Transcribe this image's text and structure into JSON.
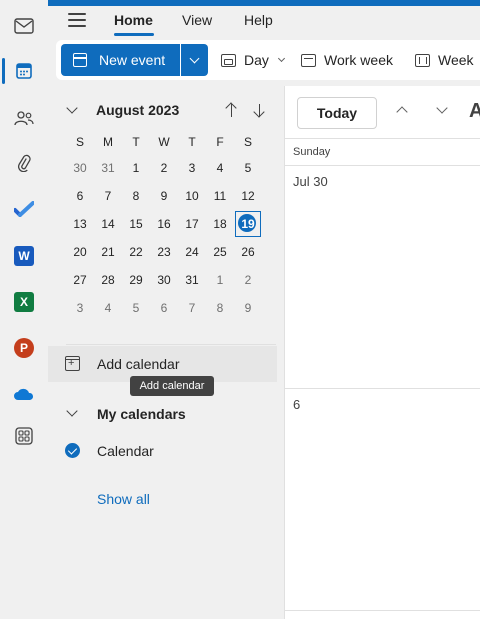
{
  "rail": {
    "items": [
      {
        "name": "mail"
      },
      {
        "name": "calendar",
        "active": true
      },
      {
        "name": "people"
      },
      {
        "name": "files"
      },
      {
        "name": "to-do"
      },
      {
        "name": "word",
        "glyph": "W",
        "color": "#185abd"
      },
      {
        "name": "excel",
        "glyph": "X",
        "color": "#107c41"
      },
      {
        "name": "powerpoint",
        "glyph": "P",
        "color": "#c43e1c"
      },
      {
        "name": "onedrive"
      },
      {
        "name": "more-apps"
      }
    ]
  },
  "ribbon": {
    "tabs": [
      "Home",
      "View",
      "Help"
    ],
    "active_tab": "Home"
  },
  "toolbar": {
    "new_event_label": "New event",
    "views": [
      "Day",
      "Work week",
      "Week"
    ]
  },
  "mini_calendar": {
    "month_label": "August 2023",
    "weekdays": [
      "S",
      "M",
      "T",
      "W",
      "T",
      "F",
      "S"
    ],
    "weeks": [
      [
        {
          "d": "30",
          "o": true
        },
        {
          "d": "31",
          "o": true
        },
        {
          "d": "1"
        },
        {
          "d": "2"
        },
        {
          "d": "3"
        },
        {
          "d": "4"
        },
        {
          "d": "5"
        }
      ],
      [
        {
          "d": "6"
        },
        {
          "d": "7"
        },
        {
          "d": "8"
        },
        {
          "d": "9"
        },
        {
          "d": "10"
        },
        {
          "d": "11"
        },
        {
          "d": "12"
        }
      ],
      [
        {
          "d": "13"
        },
        {
          "d": "14"
        },
        {
          "d": "15"
        },
        {
          "d": "16"
        },
        {
          "d": "17"
        },
        {
          "d": "18"
        },
        {
          "d": "19",
          "today": true
        }
      ],
      [
        {
          "d": "20"
        },
        {
          "d": "21"
        },
        {
          "d": "22"
        },
        {
          "d": "23"
        },
        {
          "d": "24"
        },
        {
          "d": "25"
        },
        {
          "d": "26"
        }
      ],
      [
        {
          "d": "27"
        },
        {
          "d": "28"
        },
        {
          "d": "29"
        },
        {
          "d": "30"
        },
        {
          "d": "31"
        },
        {
          "d": "1",
          "o": true
        },
        {
          "d": "2",
          "o": true
        }
      ],
      [
        {
          "d": "3",
          "o": true
        },
        {
          "d": "4",
          "o": true
        },
        {
          "d": "5",
          "o": true
        },
        {
          "d": "6",
          "o": true
        },
        {
          "d": "7",
          "o": true
        },
        {
          "d": "8",
          "o": true
        },
        {
          "d": "9",
          "o": true
        }
      ]
    ]
  },
  "sidebar": {
    "add_calendar_label": "Add calendar",
    "tooltip": "Add calendar",
    "my_calendars_label": "My calendars",
    "calendar_label": "Calendar",
    "show_all_label": "Show all"
  },
  "main": {
    "today_label": "Today",
    "cut_heading": "A",
    "column_header": "Sunday",
    "cells": [
      "Jul 30",
      "6"
    ]
  },
  "colors": {
    "accent": "#0f6cbd"
  }
}
